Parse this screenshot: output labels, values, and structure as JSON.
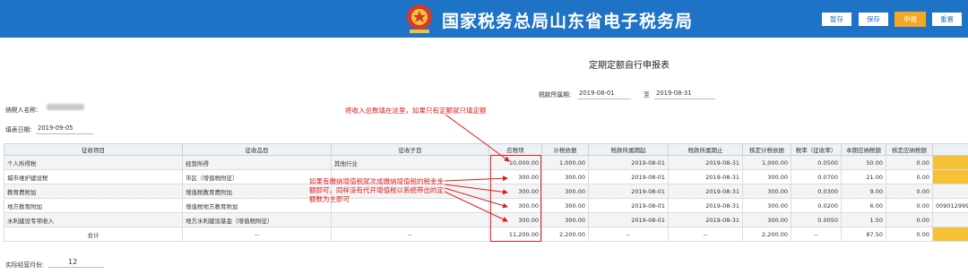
{
  "header": {
    "title": "国家税务总局山东省电子税务局",
    "buttons": [
      "暂存",
      "保存",
      "申报",
      "重置"
    ]
  },
  "form": {
    "title": "定期定额自行申报表",
    "period_label": "税款所属期:",
    "period_from": "2019-08-01",
    "period_to_label": "至",
    "period_to": "2019-08-31",
    "taxpayer_label": "纳税人名称:",
    "date_label": "填表日期:",
    "date_value": "2019-09-05",
    "months_label": "实际经营月份:",
    "months_value": "12"
  },
  "table": {
    "headers": [
      "征收项目",
      "征收品目",
      "征收子目",
      "应税项",
      "计税依据",
      "税款所属期起",
      "税款所属期止",
      "核定计税依据",
      "税率（征收率）",
      "本期应纳税额",
      "核定应纳税额",
      ""
    ],
    "rows": [
      [
        "个人所得税",
        "经营所得",
        "其他行业",
        "10,000.00",
        "1,000.00",
        "2019-08-01",
        "2019-08-31",
        "1,000.00",
        "0.0500",
        "50.00",
        "0.00",
        ""
      ],
      [
        "城市维护建设税",
        "市区（增值税附征）",
        "",
        "300.00",
        "300.00",
        "2019-08-01",
        "2019-08-31",
        "300.00",
        "0.0700",
        "21.00",
        "0.00",
        ""
      ],
      [
        "教育费附加",
        "增值税教育费附加",
        "",
        "300.00",
        "300.00",
        "2019-08-01",
        "2019-08-31",
        "300.00",
        "0.0300",
        "9.00",
        "0.00",
        ""
      ],
      [
        "地方教育附加",
        "增值税地方教育附加",
        "",
        "300.00",
        "300.00",
        "2019-08-01",
        "2019-08-31",
        "300.00",
        "0.0200",
        "6.00",
        "0.00",
        "009012999"
      ],
      [
        "水利建设专项收入",
        "地方水利建设基金（增值税附征）",
        "",
        "300.00",
        "300.00",
        "2019-08-01",
        "2019-08-31",
        "300.00",
        "0.0050",
        "1.50",
        "0.00",
        ""
      ]
    ],
    "total_row": [
      "合计",
      "--",
      "--",
      "11,200.00",
      "2,200.00",
      "--",
      "--",
      "2,200.00",
      "--",
      "87.50",
      "0.00",
      ""
    ]
  },
  "annotations": {
    "top": "将收入总数填在这里，如果只有定额就只填定额",
    "middle": "如果有缴纳增值税就次成缴纳增值税的税金金额即可，同样没有代开增值税以系统带出的定额数为主即可"
  },
  "colors": {
    "banner": "#1e73c6",
    "accent_orange": "#f5a623",
    "annotation_red": "#e01a1a",
    "highlight_yellow": "#f7c136"
  }
}
